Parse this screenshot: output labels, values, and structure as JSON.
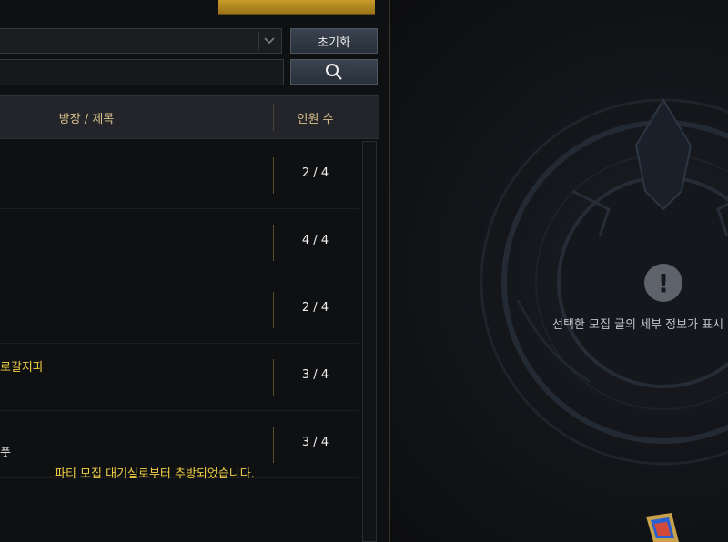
{
  "toolbar": {
    "reset_label": "초기화",
    "search_placeholder": "",
    "search_icon": "search-icon"
  },
  "list": {
    "header_title": "방장 / 제목",
    "header_count": "인원 수",
    "rows": [
      {
        "title": "",
        "count": "2 / 4"
      },
      {
        "title": "",
        "count": "4 / 4"
      },
      {
        "title": "",
        "count": "2 / 4"
      },
      {
        "title": "로갈지파",
        "count": "3 / 4"
      },
      {
        "title": "풋",
        "count": "3 / 4"
      }
    ]
  },
  "status": {
    "kick_message": "파티 모집 대기실로부터 추방되었습니다."
  },
  "detail": {
    "empty_message": "선택한 모집 글의 세부 정보가 표시"
  },
  "colors": {
    "accent_gold": "#d9c08a",
    "message_yellow": "#f2d044"
  }
}
